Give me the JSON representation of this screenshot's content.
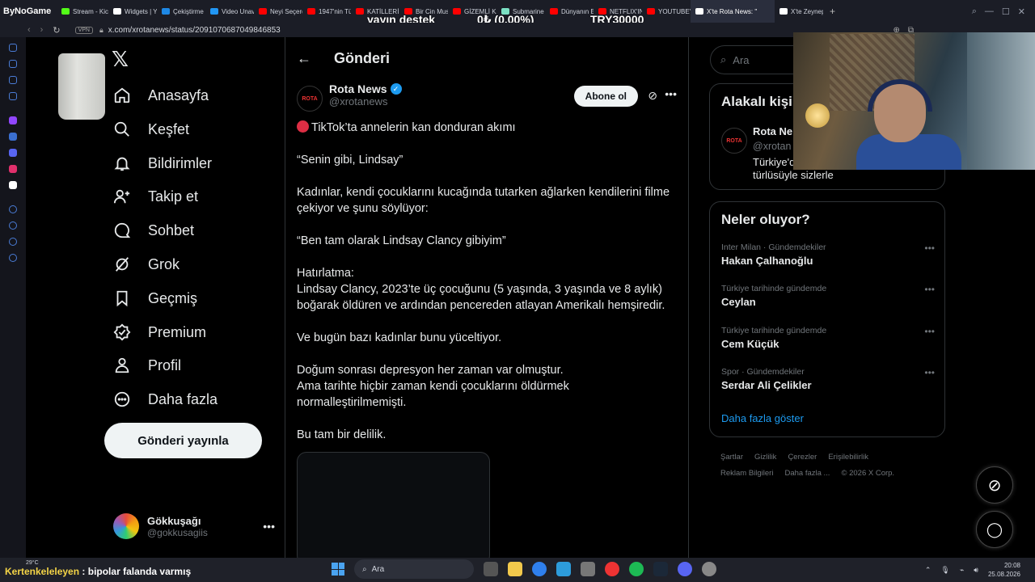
{
  "browser": {
    "brand": "ByNoGame",
    "tabs": [
      {
        "label": "Stream - Kic",
        "color": "#53fc18"
      },
      {
        "label": "Widgets | Yo",
        "color": "#ffffff"
      },
      {
        "label": "Çekiştirme",
        "color": "#1e88e5"
      },
      {
        "label": "Video Unava",
        "color": "#2196f3"
      },
      {
        "label": "Neyi Seçerd",
        "color": "#ff0000"
      },
      {
        "label": "1947'nin Tü",
        "color": "#ff0000"
      },
      {
        "label": "KATİLLERİN",
        "color": "#ff0000"
      },
      {
        "label": "Bir Cin Mus",
        "color": "#ff0000"
      },
      {
        "label": "GİZEMLİ KA",
        "color": "#ff0000"
      },
      {
        "label": "Submarine",
        "color": "#7be0c3"
      },
      {
        "label": "Dünyanın En",
        "color": "#ff0000"
      },
      {
        "label": "NETFLIX'IN",
        "color": "#ff0000"
      },
      {
        "label": "YOUTUBE'U",
        "color": "#ff0000"
      },
      {
        "label": "X'te Rota News: \"",
        "color": "#ffffff",
        "active": true
      },
      {
        "label": "X'te Zeynep",
        "color": "#ffffff"
      }
    ],
    "new_tab": "+",
    "vpn_label": "VPN",
    "url": "x.com/xrotanews/status/2091070687049846853"
  },
  "stream_overlay": {
    "left": "yayın destek",
    "mid": "0₺ (0.00%)",
    "right": "TRY30000"
  },
  "nav": {
    "items": [
      {
        "label": "Anasayfa",
        "icon": "home-icon"
      },
      {
        "label": "Keşfet",
        "icon": "search-icon"
      },
      {
        "label": "Bildirimler",
        "icon": "bell-icon"
      },
      {
        "label": "Takip et",
        "icon": "follow-icon"
      },
      {
        "label": "Sohbet",
        "icon": "chat-icon"
      },
      {
        "label": "Grok",
        "icon": "grok-icon"
      },
      {
        "label": "Geçmiş",
        "icon": "bookmark-icon"
      },
      {
        "label": "Premium",
        "icon": "premium-icon"
      },
      {
        "label": "Profil",
        "icon": "profile-icon"
      },
      {
        "label": "Daha fazla",
        "icon": "more-circle-icon"
      }
    ],
    "post_button": "Gönderi yayınla",
    "account": {
      "name": "Gökkuşağı",
      "handle": "@gokkusagiis"
    }
  },
  "main": {
    "header_title": "Gönderi",
    "author": {
      "name": "Rota News",
      "handle": "@xrotanews",
      "avatar_text": "ROTA"
    },
    "subscribe_label": "Abone ol",
    "paragraphs": [
      "TikTok’ta annelerin kan donduran akımı",
      "“Senin gibi, Lindsay”",
      "Kadınlar, kendi çocuklarını kucağında tutarken ağlarken kendilerini filme çekiyor ve şunu söylüyor:",
      "“Ben tam olarak Lindsay Clancy gibiyim”",
      "Hatırlatma:\nLindsay Clancy, 2023’te üç çocuğunu (5 yaşında, 3 yaşında ve 8 aylık) boğarak öldüren ve ardından pencereden atlayan Amerikalı hemşiredir.",
      "Ve bugün bazı kadınlar bunu yüceltiyor.",
      "Doğum sonrası depresyon her zaman var olmuştur.\nAma tarihte hiçbir zaman kendi çocuklarını öldürmek normalleştirilmemişti.",
      "Bu tam bir delilik."
    ]
  },
  "right": {
    "search_placeholder": "Ara",
    "related": {
      "title": "Alakalı kişi",
      "name": "Rota Ne",
      "handle": "@xrotan",
      "bio": "Türkiye'd\ntürlüsüyle sizlerle"
    },
    "trends": {
      "title": "Neler oluyor?",
      "items": [
        {
          "meta": "Inter Milan · Gündemdekiler",
          "name": "Hakan Çalhanoğlu"
        },
        {
          "meta": "Türkiye tarihinde gündemde",
          "name": "Ceylan"
        },
        {
          "meta": "Türkiye tarihinde gündemde",
          "name": "Cem Küçük"
        },
        {
          "meta": "Spor · Gündemdekiler",
          "name": "Serdar Ali Çelikler"
        }
      ],
      "show_more": "Daha fazla göster"
    },
    "footer": [
      "Şartlar",
      "Gizlilik",
      "Çerezler",
      "Erişilebilirlik",
      "Reklam Bilgileri",
      "Daha fazla ...",
      "© 2026 X Corp."
    ]
  },
  "chat": {
    "nick": "Kertenkeleleyen",
    "message": ": bipolar falanda varmış"
  },
  "taskbar": {
    "weather": "29°C",
    "search": "Ara",
    "time": "20:08",
    "date": "25.08.2026"
  }
}
